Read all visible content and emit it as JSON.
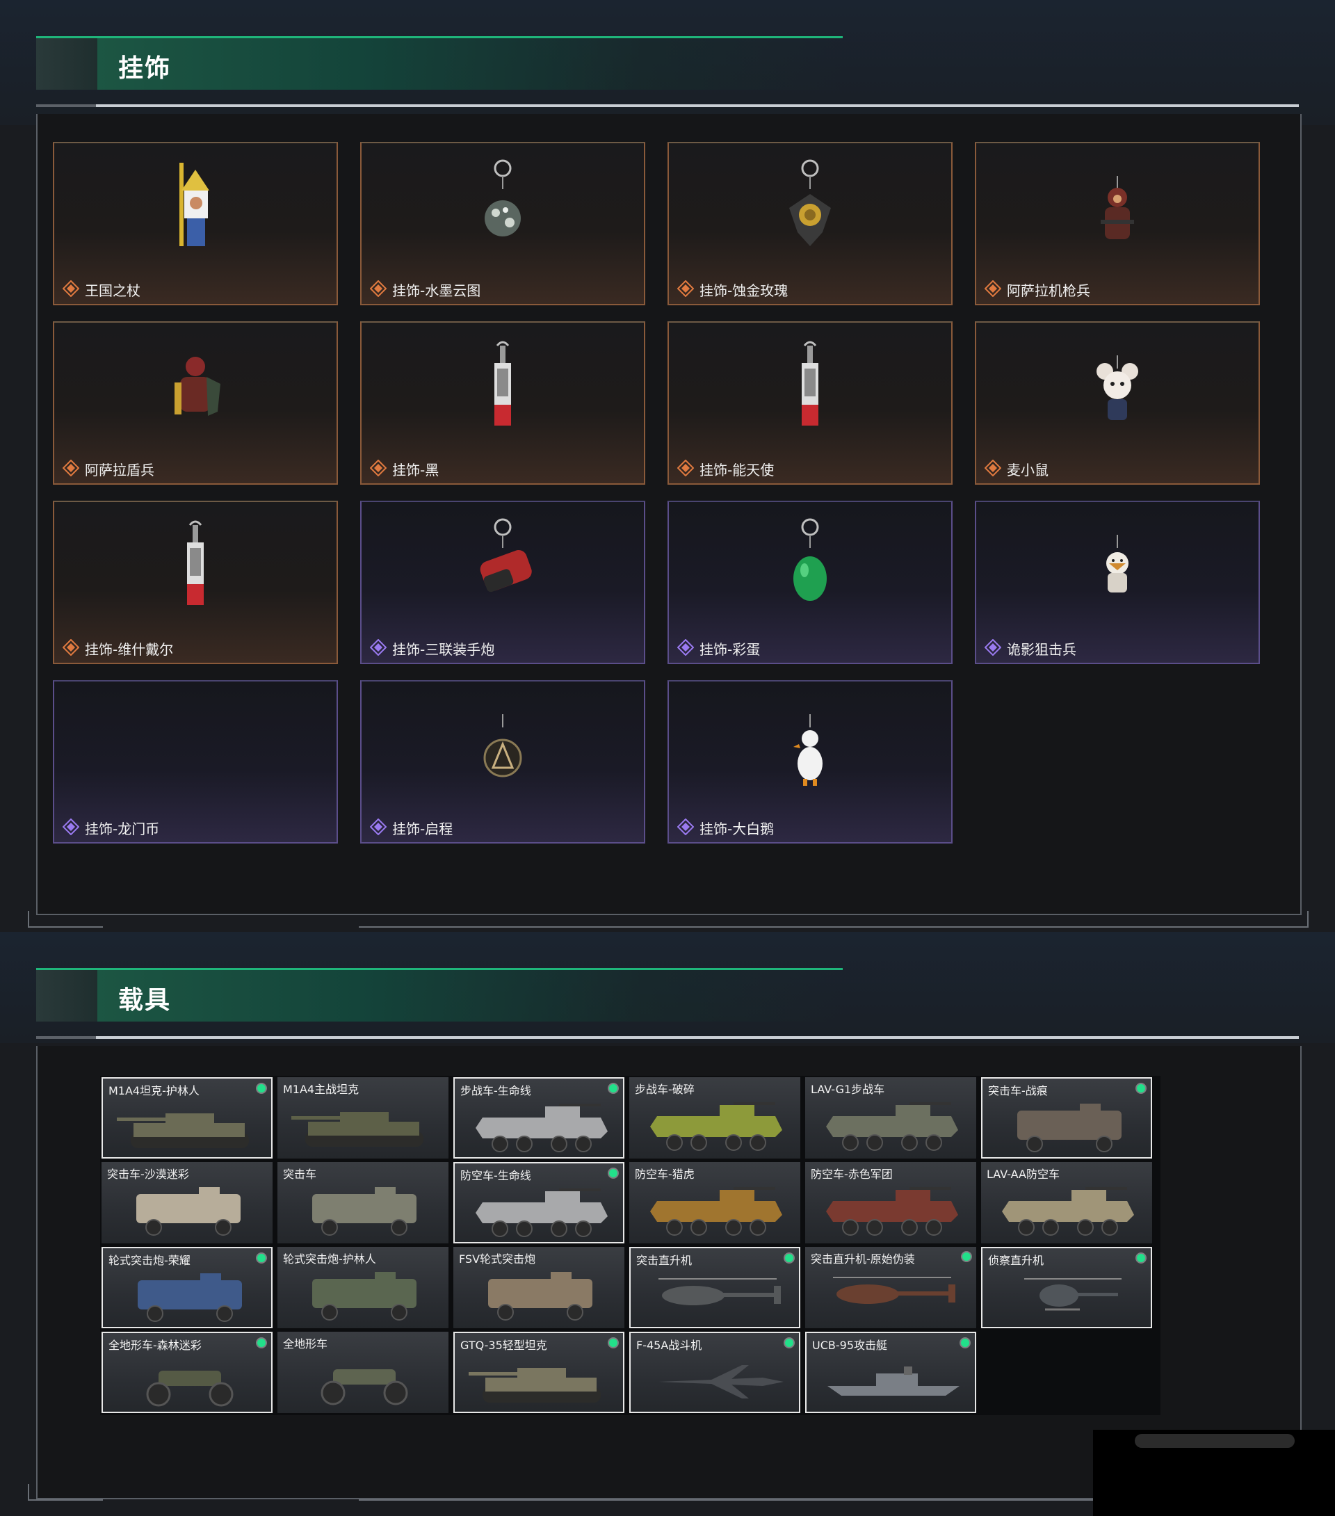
{
  "sections": {
    "pendants_title": "挂饰",
    "vehicles_title": "载具"
  },
  "pendants": [
    {
      "label": "王国之杖",
      "rarity": "gold",
      "icon": "scepter-pendant-icon"
    },
    {
      "label": "挂饰-水墨云图",
      "rarity": "gold",
      "icon": "ink-orb-pendant-icon"
    },
    {
      "label": "挂饰-蚀金玫瑰",
      "rarity": "gold",
      "icon": "gold-rose-pendant-icon"
    },
    {
      "label": "阿萨拉机枪兵",
      "rarity": "gold",
      "icon": "machine-gunner-pendant-icon"
    },
    {
      "label": "阿萨拉盾兵",
      "rarity": "gold",
      "icon": "shield-soldier-pendant-icon"
    },
    {
      "label": "挂饰-黑",
      "rarity": "gold",
      "icon": "tag-pendant-icon"
    },
    {
      "label": "挂饰-能天使",
      "rarity": "gold",
      "icon": "tag-pendant-icon"
    },
    {
      "label": "麦小鼠",
      "rarity": "gold",
      "icon": "mouse-pendant-icon"
    },
    {
      "label": "挂饰-维什戴尔",
      "rarity": "gold",
      "icon": "tag-pendant-icon"
    },
    {
      "label": "挂饰-三联装手炮",
      "rarity": "purple",
      "icon": "hand-cannon-pendant-icon"
    },
    {
      "label": "挂饰-彩蛋",
      "rarity": "purple",
      "icon": "green-egg-pendant-icon"
    },
    {
      "label": "诡影狙击兵",
      "rarity": "purple",
      "icon": "sniper-pendant-icon"
    },
    {
      "label": "挂饰-龙门币",
      "rarity": "purple",
      "icon": "coin-pendant-icon"
    },
    {
      "label": "挂饰-启程",
      "rarity": "purple",
      "icon": "medal-pendant-icon"
    },
    {
      "label": "挂饰-大白鹅",
      "rarity": "purple",
      "icon": "goose-pendant-icon"
    }
  ],
  "vehicles": [
    {
      "name": "M1A4坦克-护林人",
      "selected": true,
      "badge": true,
      "kind": "tank",
      "color": "#6b6b55"
    },
    {
      "name": "M1A4主战坦克",
      "selected": false,
      "badge": false,
      "kind": "tank",
      "color": "#5d6048"
    },
    {
      "name": "步战车-生命线",
      "selected": true,
      "badge": true,
      "kind": "ifv",
      "color": "#a8a9ab"
    },
    {
      "name": "步战车-破碎",
      "selected": false,
      "badge": false,
      "kind": "ifv",
      "color": "#8d9a3a"
    },
    {
      "name": "LAV-G1步战车",
      "selected": false,
      "badge": false,
      "kind": "ifv",
      "color": "#6c7060"
    },
    {
      "name": "突击车-战痕",
      "selected": true,
      "badge": true,
      "kind": "truck",
      "color": "#6a6056"
    },
    {
      "name": "突击车-沙漠迷彩",
      "selected": false,
      "badge": false,
      "kind": "truck",
      "color": "#b7ad9a"
    },
    {
      "name": "突击车",
      "selected": false,
      "badge": false,
      "kind": "truck",
      "color": "#7e7f70"
    },
    {
      "name": "防空车-生命线",
      "selected": true,
      "badge": true,
      "kind": "ifv",
      "color": "#a8a9ab"
    },
    {
      "name": "防空车-猎虎",
      "selected": false,
      "badge": false,
      "kind": "ifv",
      "color": "#a0752f"
    },
    {
      "name": "防空车-赤色军团",
      "selected": false,
      "badge": false,
      "kind": "ifv",
      "color": "#7a3a30"
    },
    {
      "name": "LAV-AA防空车",
      "selected": false,
      "badge": false,
      "kind": "ifv",
      "color": "#a09578"
    },
    {
      "name": "轮式突击炮-荣耀",
      "selected": true,
      "badge": true,
      "kind": "truck",
      "color": "#3f5a8a"
    },
    {
      "name": "轮式突击炮-护林人",
      "selected": false,
      "badge": false,
      "kind": "truck",
      "color": "#5a6650"
    },
    {
      "name": "FSV轮式突击炮",
      "selected": false,
      "badge": false,
      "kind": "truck",
      "color": "#8a7a65"
    },
    {
      "name": "突击直升机",
      "selected": true,
      "badge": true,
      "kind": "heli",
      "color": "#55585a"
    },
    {
      "name": "突击直升机-原始伪装",
      "selected": false,
      "badge": true,
      "kind": "heli",
      "color": "#6a4030"
    },
    {
      "name": "侦察直升机",
      "selected": true,
      "badge": true,
      "kind": "smallheli",
      "color": "#50555a"
    },
    {
      "name": "全地形车-森林迷彩",
      "selected": true,
      "badge": true,
      "kind": "atv",
      "color": "#555a45"
    },
    {
      "name": "全地形车",
      "selected": false,
      "badge": false,
      "kind": "atv",
      "color": "#5e6450"
    },
    {
      "name": "GTQ-35轻型坦克",
      "selected": true,
      "badge": true,
      "kind": "tank",
      "color": "#7a7660"
    },
    {
      "name": "F-45A战斗机",
      "selected": true,
      "badge": true,
      "kind": "jet",
      "color": "#4a4d52"
    },
    {
      "name": "UCB-95攻击艇",
      "selected": true,
      "badge": true,
      "kind": "boat",
      "color": "#7a7f86"
    }
  ],
  "colors": {
    "accent_green": "#1fb57a",
    "gold_border": "#8a5a3a",
    "purple_border": "#5b4e8a",
    "badge": "#22e08a"
  }
}
